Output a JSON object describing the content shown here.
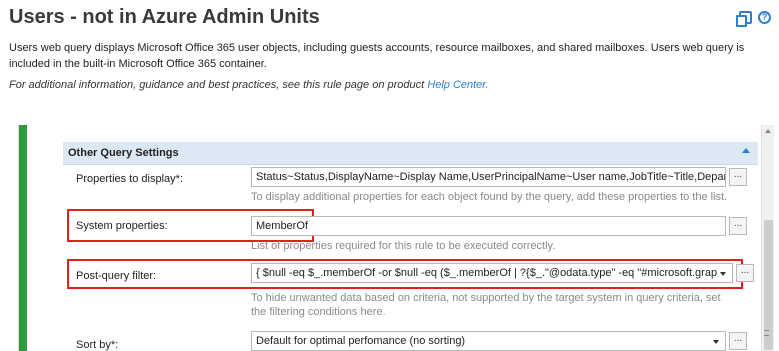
{
  "header": {
    "title": "Users - not in Azure Admin Units",
    "icons": [
      "copy-icon",
      "help-icon"
    ]
  },
  "description": "Users web query displays Microsoft Office 365 user objects, including guests accounts, resource mailboxes, and shared mailboxes. Users web query is included in the built-in Microsoft Office 365 container.",
  "note": {
    "text": "For additional information, guidance and best practices, see this rule page on product ",
    "link": "Help Center."
  },
  "section": {
    "title": "Other Query Settings",
    "accent_color": "#2e9b3f",
    "highlight_color": "#e01f1f",
    "rows": {
      "properties": {
        "label": "Properties to display*:",
        "value": "Status~Status,DisplayName~Display Name,UserPrincipalName~User name,JobTitle~Title,Departme",
        "hint": "To display additional properties for each object found by the query, add these properties to the list.",
        "button": "..."
      },
      "system": {
        "label": "System properties:",
        "value": "MemberOf",
        "hint": "List of properties required for this rule to be executed correctly.",
        "button": "..."
      },
      "filter": {
        "label": "Post-query filter:",
        "value": "{ $null -eq $_.memberOf -or $null -eq ($_.memberOf | ?{$_.\"@odata.type\" -eq \"#microsoft.grap",
        "hint": "To hide unwanted data based on criteria, not supported by the target system in query criteria, set the filtering conditions here.",
        "button": "..."
      },
      "sort": {
        "label": "Sort by*:",
        "value": "Default for optimal perfomance (no sorting)",
        "button": "..."
      }
    }
  }
}
